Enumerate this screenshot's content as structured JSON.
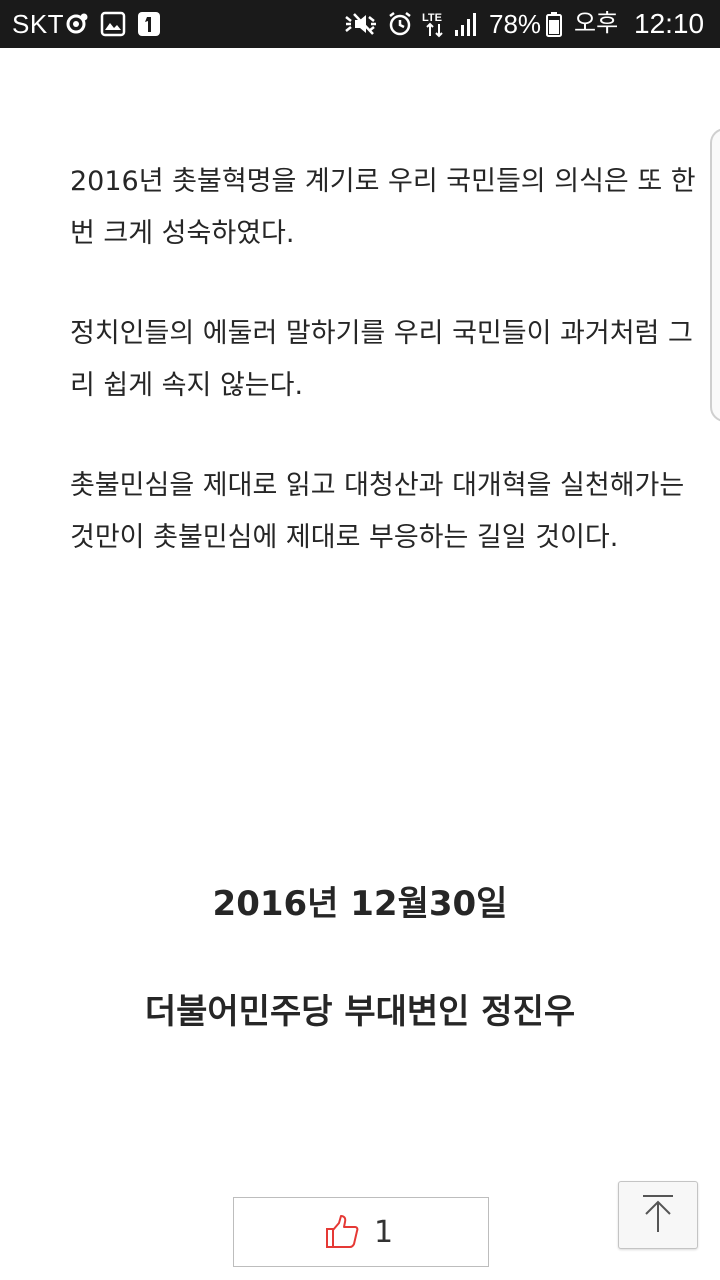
{
  "status_bar": {
    "carrier": "SKT",
    "battery_percent": "78%",
    "ampm": "오후",
    "time": "12:10",
    "icons": [
      "sync-icon",
      "gallery-icon",
      "notification-one-icon",
      "mute-icon",
      "alarm-icon",
      "lte-icon",
      "signal-icon",
      "battery-icon"
    ]
  },
  "article": {
    "paragraphs": [
      "2016년 촛불혁명을 계기로 우리 국민들의 의식은 또 한 번 크게 성숙하였다.",
      "정치인들의 에둘러 말하기를 우리 국민들이 과거처럼 그리 쉽게 속지 않는다.",
      "촛불민심을 제대로 읽고 대청산과 대개혁을 실천해가는 것만이 촛불민심에 제대로 부응하는 길일 것이다."
    ],
    "date": "2016년 12월30일",
    "author": "더불어민주당 부대변인 정진우"
  },
  "like": {
    "count": "1",
    "icon": "thumbs-up-icon",
    "icon_color": "#e53935"
  },
  "scroll_top": {
    "icon": "arrow-up-icon"
  }
}
